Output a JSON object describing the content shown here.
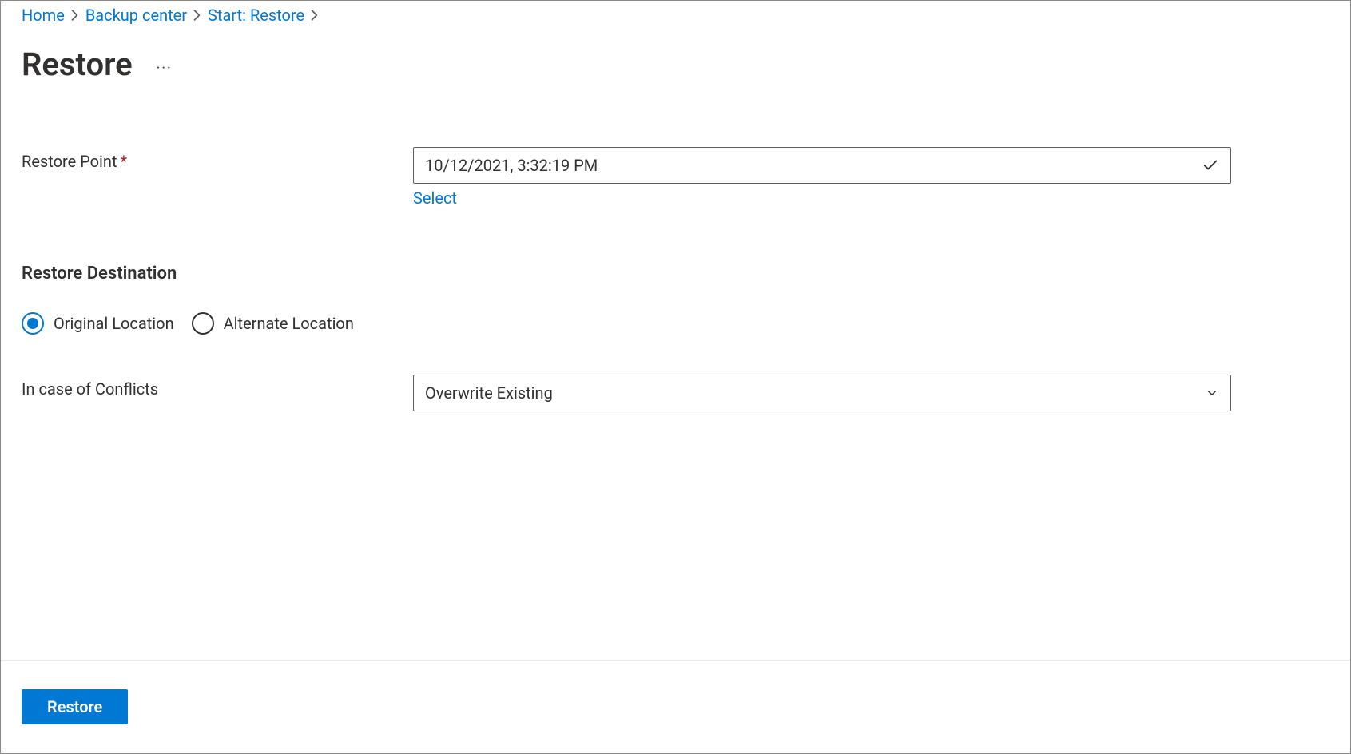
{
  "breadcrumb": {
    "items": [
      {
        "label": "Home"
      },
      {
        "label": "Backup center"
      },
      {
        "label": "Start: Restore"
      }
    ]
  },
  "page": {
    "title": "Restore"
  },
  "form": {
    "restore_point": {
      "label": "Restore Point",
      "value": "10/12/2021, 3:32:19 PM",
      "select_link": "Select"
    },
    "destination": {
      "section_title": "Restore Destination",
      "options": {
        "original": "Original Location",
        "alternate": "Alternate Location"
      },
      "selected": "original"
    },
    "conflicts": {
      "label": "In case of Conflicts",
      "value": "Overwrite Existing"
    }
  },
  "footer": {
    "restore_button": "Restore"
  }
}
